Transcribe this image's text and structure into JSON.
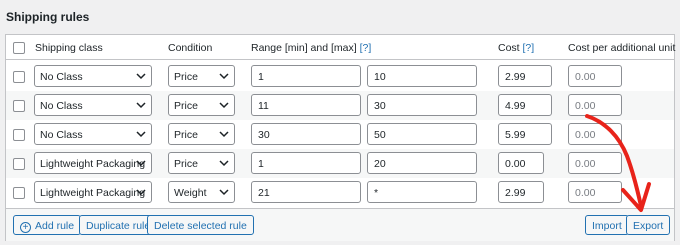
{
  "section": {
    "title": "Shipping rules"
  },
  "columns": {
    "shipping_class": "Shipping class",
    "condition": "Condition",
    "range": "Range [min] and [max]",
    "range_help": "[?]",
    "cost": "Cost",
    "cost_help": "[?]",
    "cost_additional": "Cost per additional unit"
  },
  "rows": [
    {
      "shipping_class": "No Class",
      "condition": "Price",
      "min": "1",
      "max": "10",
      "cost": "2.99",
      "cost_additional": "0.00"
    },
    {
      "shipping_class": "No Class",
      "condition": "Price",
      "min": "11",
      "max": "30",
      "cost": "4.99",
      "cost_additional": "0.00"
    },
    {
      "shipping_class": "No Class",
      "condition": "Price",
      "min": "30",
      "max": "50",
      "cost": "5.99",
      "cost_additional": "0.00"
    },
    {
      "shipping_class": "Lightweight Packaging",
      "condition": "Price",
      "min": "1",
      "max": "20",
      "cost": "0.00",
      "cost_additional": "0.00"
    },
    {
      "shipping_class": "Lightweight Packaging",
      "condition": "Weight",
      "min": "21",
      "max": "*",
      "cost": "2.99",
      "cost_additional": "0.00"
    }
  ],
  "footer": {
    "add_rule": "Add rule",
    "duplicate_rule": "Duplicate rule",
    "delete_selected_rule": "Delete selected rule",
    "import": "Import",
    "export": "Export"
  },
  "icons": {
    "select_arrow": "chevron-down-icon",
    "add": "plus-circle-icon",
    "annotation": "red-arrow-icon"
  },
  "colors": {
    "accent": "#2271b1",
    "annotation_arrow": "#e8231a"
  }
}
